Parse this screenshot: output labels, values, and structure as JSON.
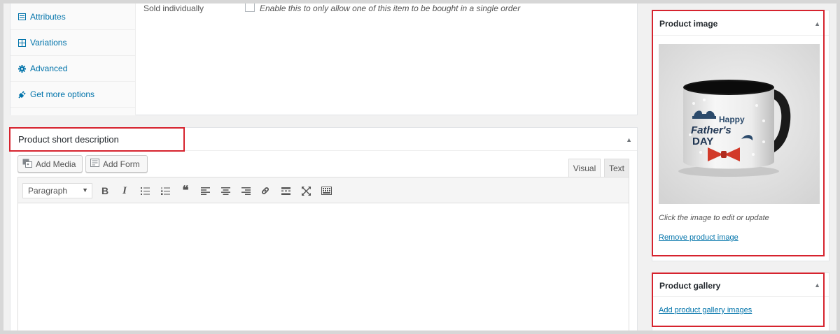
{
  "product_data": {
    "tabs": [
      {
        "label": "Attributes",
        "icon": "list-icon"
      },
      {
        "label": "Variations",
        "icon": "grid-icon"
      },
      {
        "label": "Advanced",
        "icon": "gear-icon"
      },
      {
        "label": "Get more options",
        "icon": "plug-icon"
      }
    ],
    "sold_individually": {
      "label": "Sold individually",
      "checked": false,
      "description": "Enable this to only allow one of this item to be bought in a single order"
    }
  },
  "short_description": {
    "title": "Product short description",
    "add_media_label": "Add Media",
    "add_form_label": "Add Form",
    "tab_visual": "Visual",
    "tab_text": "Text",
    "active_tab": "Visual",
    "format_value": "Paragraph",
    "toolbar_icons": [
      "bold-icon",
      "italic-icon",
      "bullet-list-icon",
      "numbered-list-icon",
      "blockquote-icon",
      "align-left-icon",
      "align-center-icon",
      "align-right-icon",
      "link-icon",
      "read-more-icon",
      "fullscreen-icon",
      "toolbar-toggle-icon"
    ],
    "toolbar_glyphs": [
      "B",
      "I",
      "☰",
      "☷",
      "❝",
      "≡",
      "≡",
      "≡",
      "🔗",
      "▬",
      "⤢",
      "▦"
    ]
  },
  "product_image": {
    "title": "Product image",
    "hint": "Click the image to edit or update",
    "remove_label": "Remove product image",
    "mug_text": [
      "Happy",
      "Father's",
      "DAY"
    ]
  },
  "product_gallery": {
    "title": "Product gallery",
    "add_label": "Add product gallery images"
  },
  "colors": {
    "highlight": "#d6232e",
    "link": "#0073aa"
  }
}
